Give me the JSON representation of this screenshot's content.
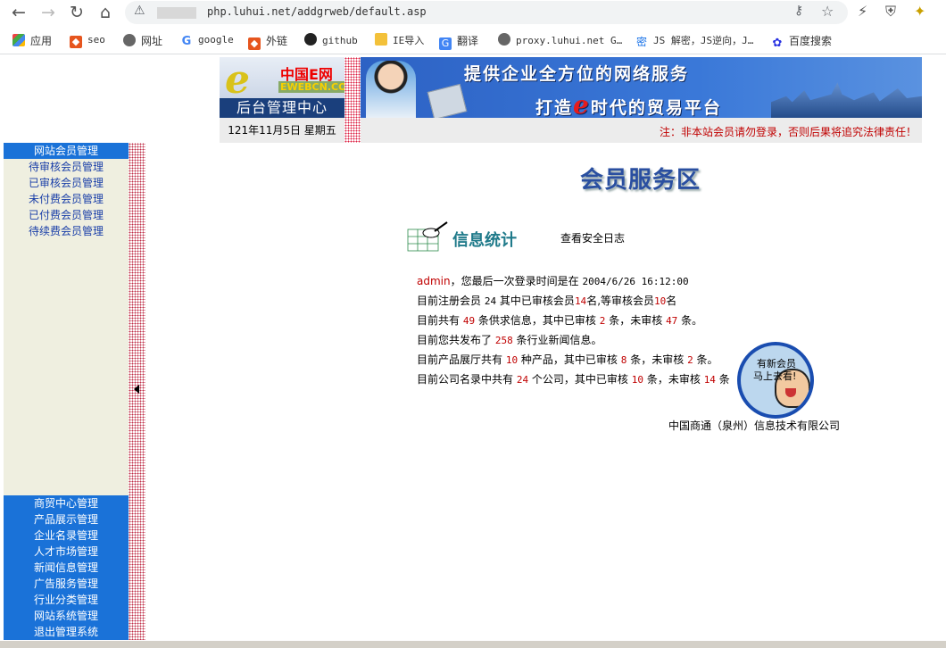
{
  "browser": {
    "url": "php.luhui.net/addgrweb/default.asp",
    "bookmarks": [
      "应用",
      "seo",
      "网址",
      "google",
      "外链",
      "github",
      "IE导入",
      "翻译",
      "proxy.luhui.net G…",
      "JS 解密，JS逆向，J…",
      "百度搜索"
    ]
  },
  "header": {
    "logo_brand": "中国E网",
    "logo_sub": "EWEBCN.COM",
    "logo_title": "后台管理中心",
    "slogan_line1": "提供企业全方位的网络服务",
    "slogan_line2_pre": "打造",
    "slogan_line2_e": "e",
    "slogan_line2_post": "时代的贸易平台",
    "date": "121年11月5日 星期五",
    "notice": "注：非本站会员请勿登录，否则后果将追究法律责任！"
  },
  "sidebar": {
    "member_header": "网站会员管理",
    "member_items": [
      "待审核会员管理",
      "已审核会员管理",
      "未付费会员管理",
      "已付费会员管理",
      "待续费会员管理"
    ],
    "bottom_items": [
      "商贸中心管理",
      "产品展示管理",
      "企业名录管理",
      "人才市场管理",
      "新闻信息管理",
      "广告服务管理",
      "行业分类管理",
      "网站系统管理",
      "退出管理系统"
    ]
  },
  "main": {
    "title": "会员服务区",
    "stats_title": "信息统计",
    "log_link": "查看安全日志",
    "admin": "admin",
    "last_login_label": "，您最后一次登录时间是在",
    "last_login_time": "2004/6/26 16:12:00",
    "line2_a": "目前注册会员",
    "members_total": "24",
    "line2_b": "其中已审核会员",
    "members_approved": "14",
    "line2_c": "名,等审核会员",
    "members_pending": "10",
    "line2_d": "名",
    "line3_a": "目前共有",
    "supply_total": "49",
    "line3_b": "条供求信息，其中已审核",
    "supply_approved": "2",
    "line3_c": "条，未审核",
    "supply_pending": "47",
    "line3_d": "条。",
    "line4_a": "目前您共发布了",
    "news_total": "258",
    "line4_b": "条行业新闻信息。",
    "line5_a": "目前产品展厅共有",
    "products_total": "10",
    "line5_b": "种产品，其中已审核",
    "products_approved": "8",
    "line5_c": "条，未审核",
    "products_pending": "2",
    "line5_d": "条。",
    "line6_a": "目前公司名录中共有",
    "companies_total": "24",
    "line6_b": "个公司，其中已审核",
    "companies_approved": "10",
    "line6_c": "条，未审核",
    "companies_pending": "14",
    "line6_d": "条",
    "badge_line1": "有新会员",
    "badge_line2": "马上去看!",
    "company": "中国商通（泉州）信息技术有限公司"
  }
}
